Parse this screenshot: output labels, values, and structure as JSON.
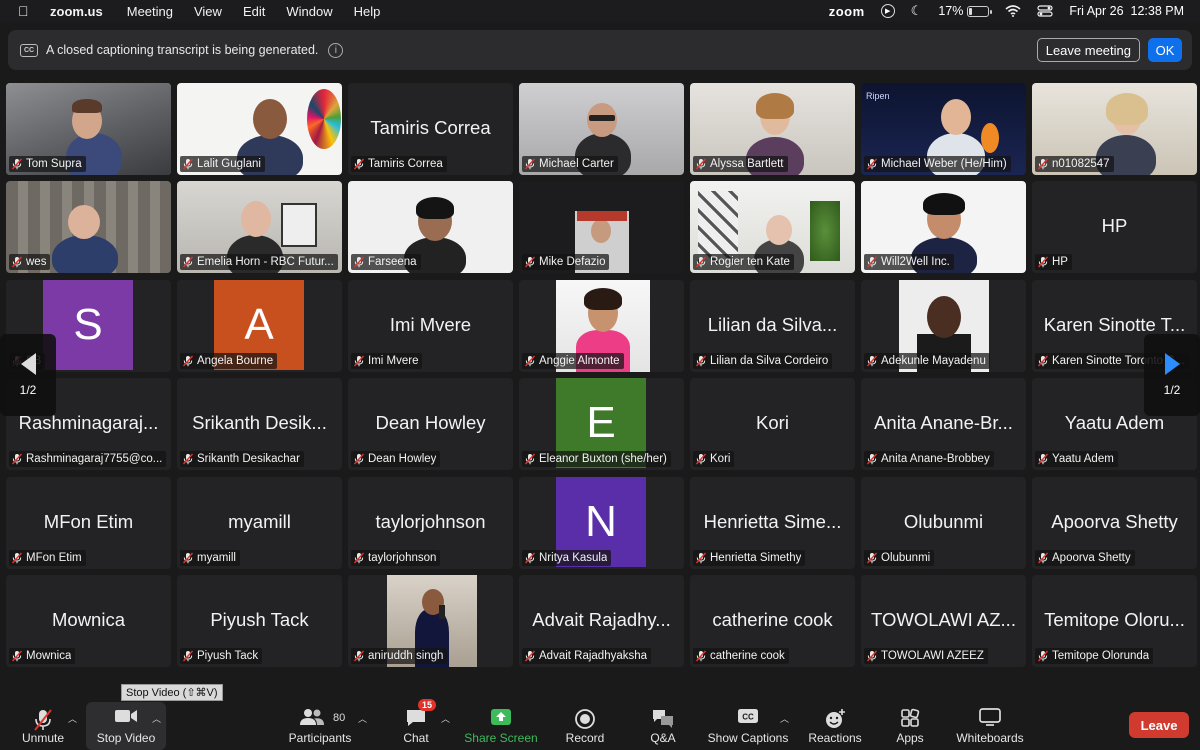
{
  "menubar": {
    "app": "zoom.us",
    "items": [
      "Meeting",
      "View",
      "Edit",
      "Window",
      "Help"
    ],
    "zoom_label": "zoom",
    "battery": "17%",
    "battery_level": 0.17,
    "datetime": "Fri Apr 26  12:38 PM"
  },
  "banner": {
    "badge": "CC",
    "text": "A closed captioning transcript is being generated.",
    "info": "i",
    "leave_label": "Leave meeting",
    "ok_label": "OK"
  },
  "pager": {
    "left": "1/2",
    "right": "1/2"
  },
  "tiles": [
    {
      "name": "Tom Supra",
      "kind": "video",
      "active": true
    },
    {
      "name": "Lalit Guglani",
      "kind": "video"
    },
    {
      "name": "Tamiris Correa",
      "kind": "text",
      "big": "Tamiris Correa"
    },
    {
      "name": "Michael Carter",
      "kind": "video"
    },
    {
      "name": "Alyssa Bartlett",
      "kind": "video"
    },
    {
      "name": "Michael Weber (He/Him)",
      "kind": "video"
    },
    {
      "name": "n01082547",
      "kind": "video"
    },
    {
      "name": "wes",
      "kind": "video"
    },
    {
      "name": "Emelia Horn - RBC Futur...",
      "kind": "video"
    },
    {
      "name": "Farseena",
      "kind": "video"
    },
    {
      "name": "Mike Defazio",
      "kind": "video"
    },
    {
      "name": "Rogier ten Kate",
      "kind": "video"
    },
    {
      "name": "Will2Well Inc.",
      "kind": "video"
    },
    {
      "name": "HP",
      "kind": "text",
      "big": "HP"
    },
    {
      "name": "SB",
      "kind": "avatar",
      "letter": "S",
      "color": "#7b3aa6"
    },
    {
      "name": "Angela Bourne",
      "kind": "avatar",
      "letter": "A",
      "color": "#c8501f"
    },
    {
      "name": "Imi Mvere",
      "kind": "text",
      "big": "Imi Mvere"
    },
    {
      "name": "Anggie Almonte",
      "kind": "photo"
    },
    {
      "name": "Lilian da Silva Cordeiro",
      "kind": "text",
      "big": "Lilian da Silva..."
    },
    {
      "name": "Adekunle Mayadenu",
      "kind": "photo"
    },
    {
      "name": "Karen Sinotte Toronto G...",
      "kind": "text",
      "big": "Karen Sinotte T..."
    },
    {
      "name": "Rashminagaraj7755@co...",
      "kind": "text",
      "big": "Rashminagaraj..."
    },
    {
      "name": "Srikanth Desikachar",
      "kind": "text",
      "big": "Srikanth Desik..."
    },
    {
      "name": "Dean Howley",
      "kind": "text",
      "big": "Dean Howley"
    },
    {
      "name": "Eleanor Buxton (she/her)",
      "kind": "avatar",
      "letter": "E",
      "color": "#3e7a29"
    },
    {
      "name": "Kori",
      "kind": "text",
      "big": "Kori"
    },
    {
      "name": "Anita Anane-Brobbey",
      "kind": "text",
      "big": "Anita Anane-Br..."
    },
    {
      "name": "Yaatu Adem",
      "kind": "text",
      "big": "Yaatu Adem"
    },
    {
      "name": "MFon Etim",
      "kind": "text",
      "big": "MFon Etim"
    },
    {
      "name": "myamill",
      "kind": "text",
      "big": "myamill"
    },
    {
      "name": "taylorjohnson",
      "kind": "text",
      "big": "taylorjohnson"
    },
    {
      "name": "Nritya Kasula",
      "kind": "avatar",
      "letter": "N",
      "color": "#5a2ea8"
    },
    {
      "name": "Henrietta Simethy",
      "kind": "text",
      "big": "Henrietta Sime..."
    },
    {
      "name": "Olubunmi",
      "kind": "text",
      "big": "Olubunmi"
    },
    {
      "name": "Apoorva Shetty",
      "kind": "text",
      "big": "Apoorva Shetty"
    },
    {
      "name": "Mownica",
      "kind": "text",
      "big": "Mownica"
    },
    {
      "name": "Piyush Tack",
      "kind": "text",
      "big": "Piyush Tack"
    },
    {
      "name": "aniruddh singh",
      "kind": "photo"
    },
    {
      "name": "Advait Rajadhyaksha",
      "kind": "text",
      "big": "Advait Rajadhy..."
    },
    {
      "name": "catherine cook",
      "kind": "text",
      "big": "catherine cook"
    },
    {
      "name": "TOWOLAWI AZEEZ",
      "kind": "text",
      "big": "TOWOLAWI AZ..."
    },
    {
      "name": "Temitope Olorunda",
      "kind": "text",
      "big": "Temitope Oloru..."
    }
  ],
  "tooltip": "Stop Video (⇧⌘V)",
  "toolbar": {
    "unmute": "Unmute",
    "stop_video": "Stop Video",
    "participants": "Participants",
    "participants_count": "80",
    "chat": "Chat",
    "chat_badge": "15",
    "share_screen": "Share Screen",
    "record": "Record",
    "qa": "Q&A",
    "show_captions": "Show Captions",
    "reactions": "Reactions",
    "apps": "Apps",
    "whiteboards": "Whiteboards",
    "leave": "Leave"
  },
  "colors": {
    "accent_green": "#8fd16a",
    "share_green": "#3dbb5b",
    "leave_red": "#d13b2f",
    "ok_blue": "#0e71eb"
  }
}
